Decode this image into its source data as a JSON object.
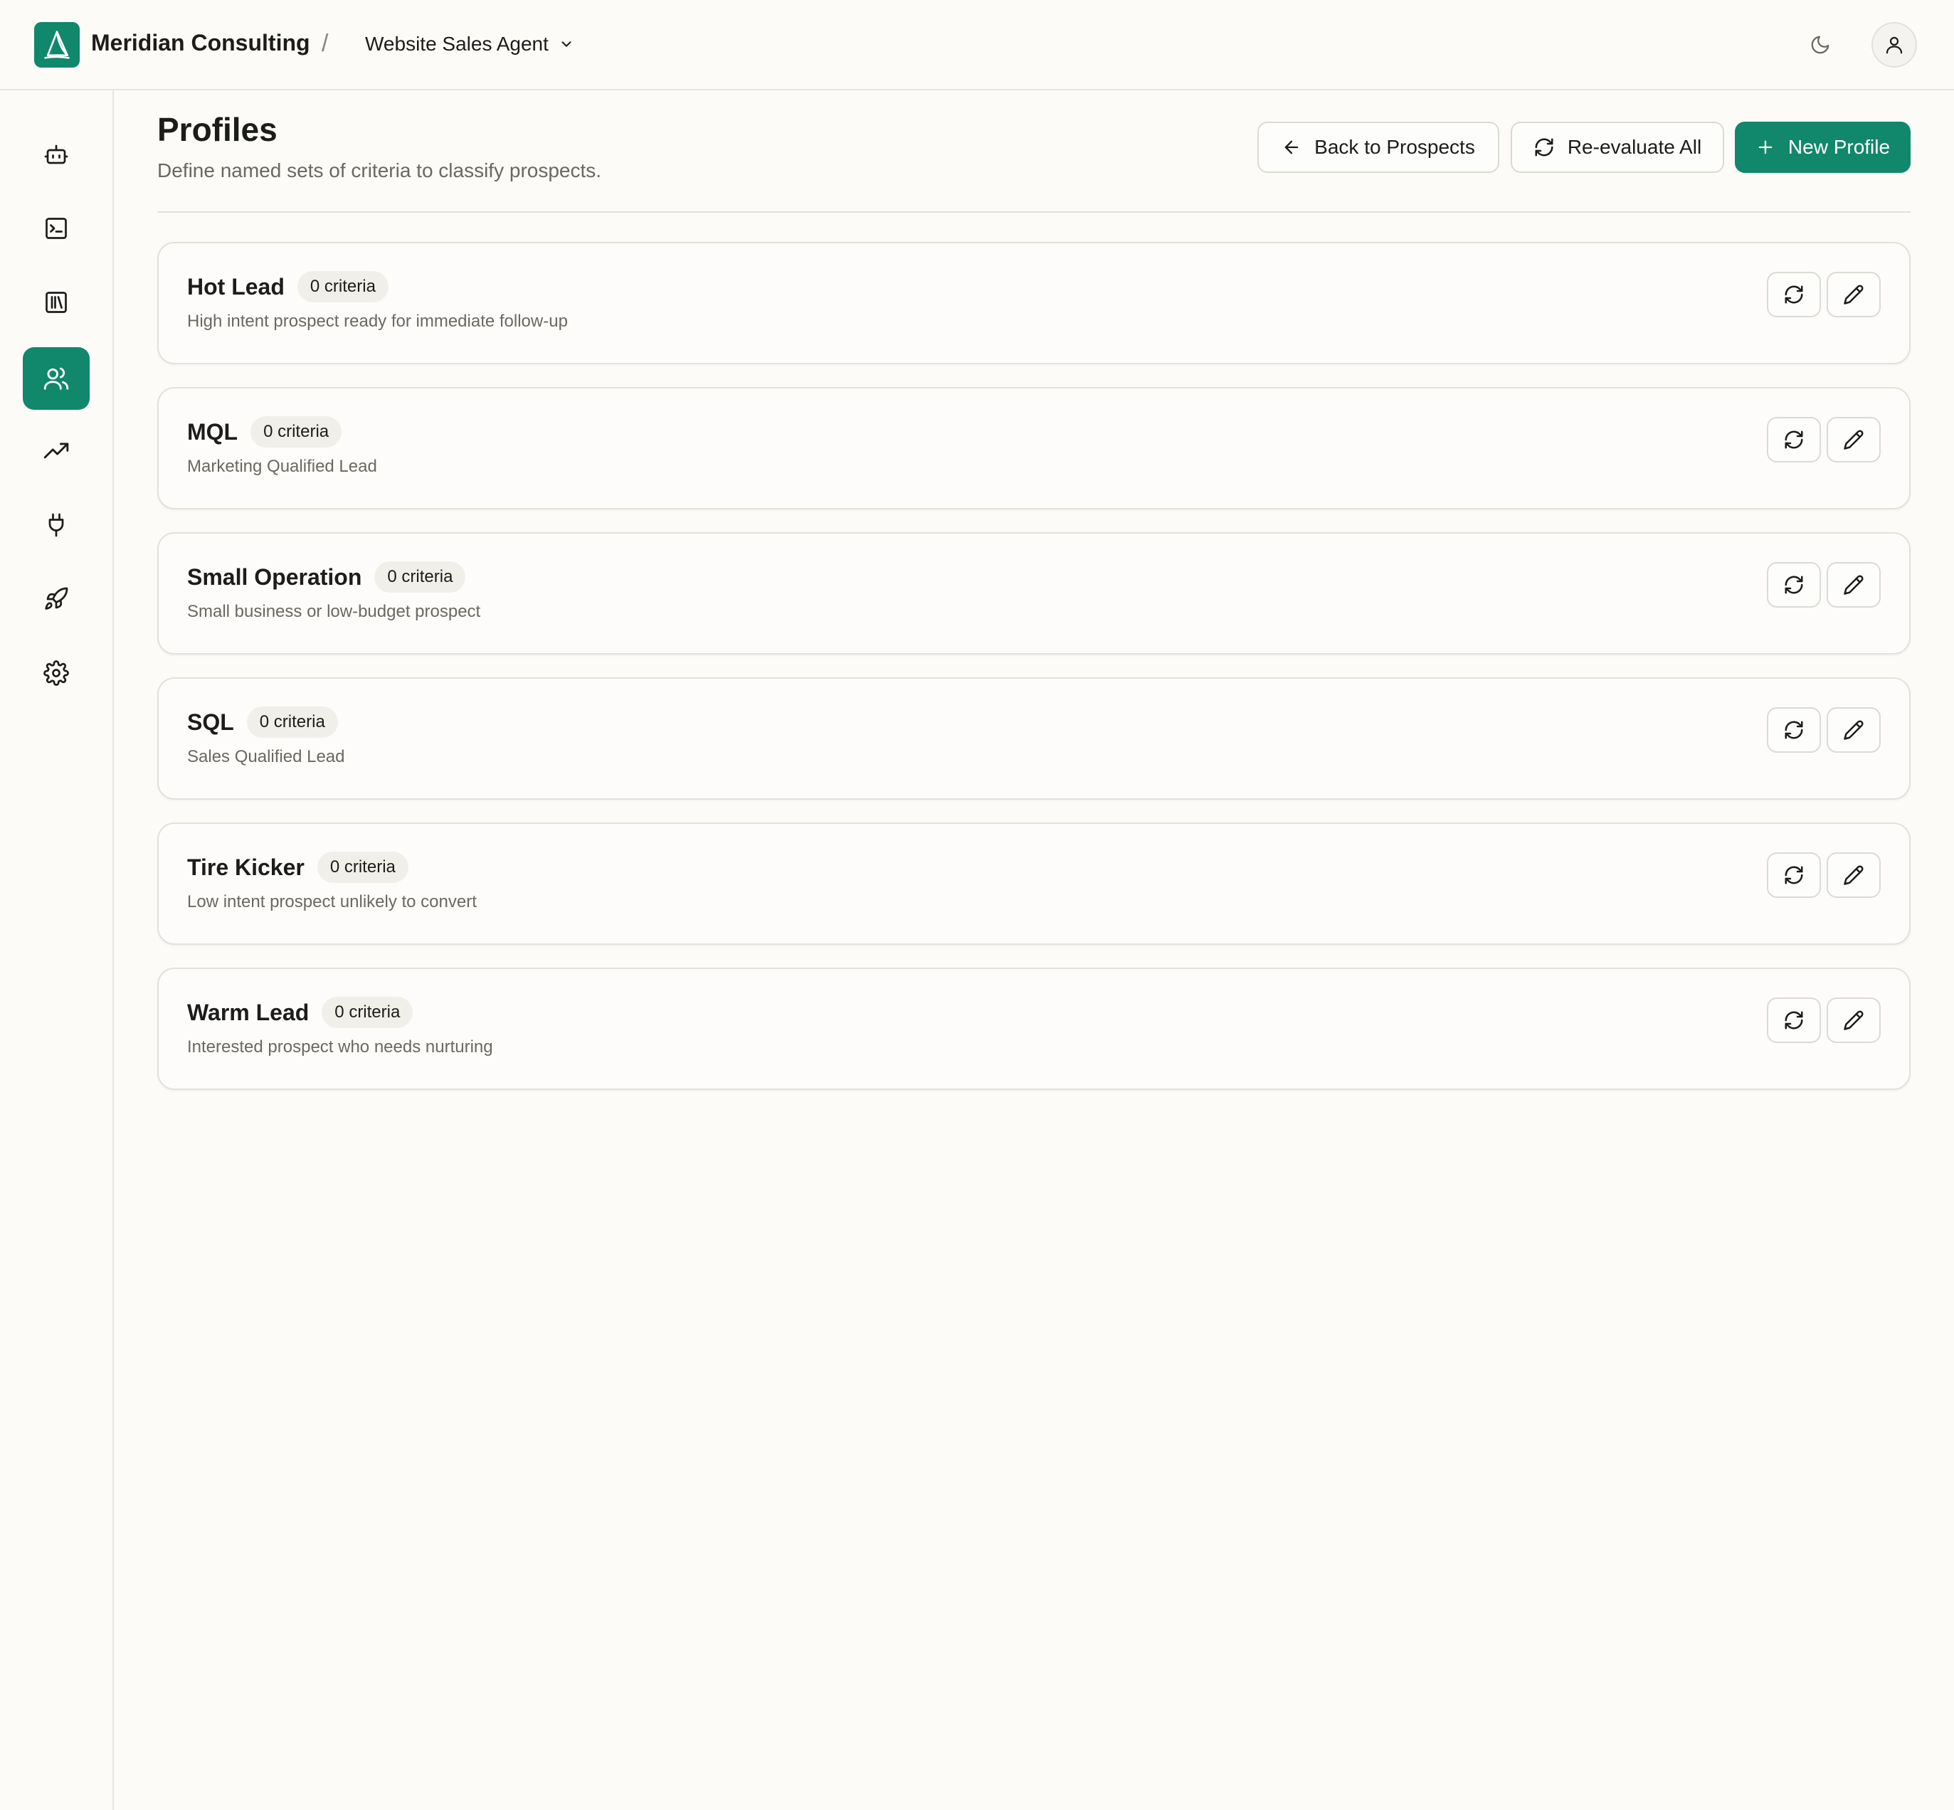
{
  "header": {
    "org_name": "Meridian Consulting",
    "separator": "/",
    "agent_name": "Website Sales Agent",
    "logo_icon": "sailboat-icon",
    "theme_icon": "moon-icon",
    "avatar_icon": "user-icon"
  },
  "sidebar": {
    "items": [
      {
        "id": "agents",
        "icon": "bot-icon"
      },
      {
        "id": "terminal",
        "icon": "terminal-icon"
      },
      {
        "id": "library",
        "icon": "library-icon"
      },
      {
        "id": "prospects",
        "icon": "users-icon",
        "active": true
      },
      {
        "id": "analytics",
        "icon": "trending-up-icon"
      },
      {
        "id": "integrations",
        "icon": "plug-icon"
      },
      {
        "id": "deploy",
        "icon": "rocket-icon"
      },
      {
        "id": "settings",
        "icon": "gear-icon"
      }
    ]
  },
  "page": {
    "title": "Profiles",
    "subtitle": "Define named sets of criteria to classify prospects."
  },
  "actions": {
    "back_label": "Back to Prospects",
    "reevaluate_label": "Re-evaluate All",
    "new_label": "New Profile"
  },
  "profiles": [
    {
      "name": "Hot Lead",
      "criteria": "0 criteria",
      "description": "High intent prospect ready for immediate follow-up"
    },
    {
      "name": "MQL",
      "criteria": "0 criteria",
      "description": "Marketing Qualified Lead"
    },
    {
      "name": "Small Operation",
      "criteria": "0 criteria",
      "description": "Small business or low-budget prospect"
    },
    {
      "name": "SQL",
      "criteria": "0 criteria",
      "description": "Sales Qualified Lead"
    },
    {
      "name": "Tire Kicker",
      "criteria": "0 criteria",
      "description": "Low intent prospect unlikely to convert"
    },
    {
      "name": "Warm Lead",
      "criteria": "0 criteria",
      "description": "Interested prospect who needs nurturing"
    }
  ],
  "colors": {
    "accent": "#11876b",
    "background": "#fcfbf8",
    "border": "#e3e1dc",
    "text": "#1c1c1a",
    "muted_text": "#6b6861"
  }
}
